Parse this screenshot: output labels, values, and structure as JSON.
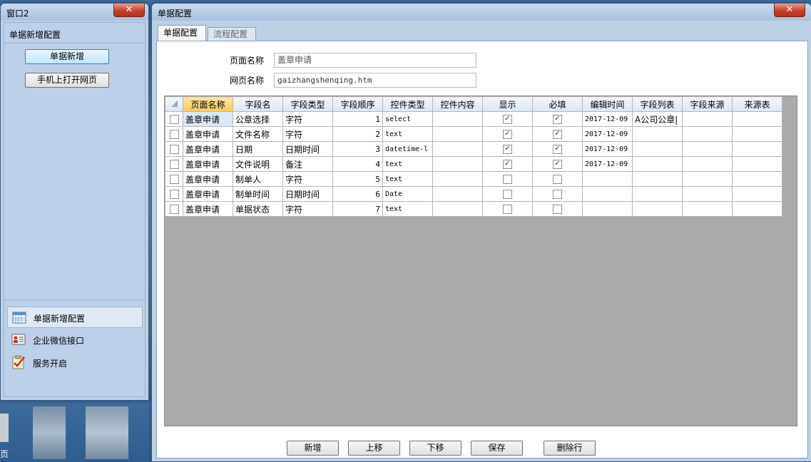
{
  "left_window": {
    "title": "窗口2",
    "panel_title": "单据新增配置",
    "buttons": [
      "单据新增",
      "手机上打开网页"
    ],
    "nav": [
      {
        "label": "单据新增配置",
        "icon": "calendar-icon",
        "selected": true
      },
      {
        "label": "企业微信接口",
        "icon": "contact-card-icon",
        "selected": false
      },
      {
        "label": "服务开启",
        "icon": "checklist-icon",
        "selected": false
      }
    ]
  },
  "desktop": {
    "partial_label": "页"
  },
  "main_window": {
    "title": "单据配置",
    "close": "✕",
    "tabs": [
      {
        "label": "单据配置",
        "active": true
      },
      {
        "label": "流程配置",
        "active": false
      }
    ],
    "form": {
      "page_name_label": "页面名称",
      "page_name_value": "盖章申请",
      "web_name_label": "网页名称",
      "web_name_value": "gaizhangshenqing.htm"
    },
    "grid": {
      "columns": [
        "页面名称",
        "字段名",
        "字段类型",
        "字段顺序",
        "控件类型",
        "控件内容",
        "显示",
        "必填",
        "编辑时间",
        "字段列表",
        "字段来源",
        "来源表"
      ],
      "rows": [
        {
          "page": "盖章申请",
          "field": "公章选择",
          "type": "字符",
          "order": "1",
          "control": "select",
          "content": "",
          "show": true,
          "required": true,
          "edit_time": "2017-12-09",
          "list": "A公司公章|",
          "source": "",
          "table": ""
        },
        {
          "page": "盖章申请",
          "field": "文件名称",
          "type": "字符",
          "order": "2",
          "control": "text",
          "content": "",
          "show": true,
          "required": true,
          "edit_time": "2017-12-09",
          "list": "",
          "source": "",
          "table": ""
        },
        {
          "page": "盖章申请",
          "field": "日期",
          "type": "日期时间",
          "order": "3",
          "control": "datetime-l",
          "content": "",
          "show": true,
          "required": true,
          "edit_time": "2017-12-09",
          "list": "",
          "source": "",
          "table": ""
        },
        {
          "page": "盖章申请",
          "field": "文件说明",
          "type": "备注",
          "order": "4",
          "control": "text",
          "content": "",
          "show": true,
          "required": true,
          "edit_time": "2017-12-09",
          "list": "",
          "source": "",
          "table": ""
        },
        {
          "page": "盖章申请",
          "field": "制单人",
          "type": "字符",
          "order": "5",
          "control": "text",
          "content": "",
          "show": false,
          "required": false,
          "edit_time": "",
          "list": "",
          "source": "",
          "table": ""
        },
        {
          "page": "盖章申请",
          "field": "制单时间",
          "type": "日期时间",
          "order": "6",
          "control": "Date",
          "content": "",
          "show": false,
          "required": false,
          "edit_time": "",
          "list": "",
          "source": "",
          "table": ""
        },
        {
          "page": "盖章申请",
          "field": "单据状态",
          "type": "字符",
          "order": "7",
          "control": "text",
          "content": "",
          "show": false,
          "required": false,
          "edit_time": "",
          "list": "",
          "source": "",
          "table": ""
        }
      ]
    },
    "bottom_buttons": [
      "新增",
      "上移",
      "下移",
      "保存",
      "删除行"
    ]
  }
}
